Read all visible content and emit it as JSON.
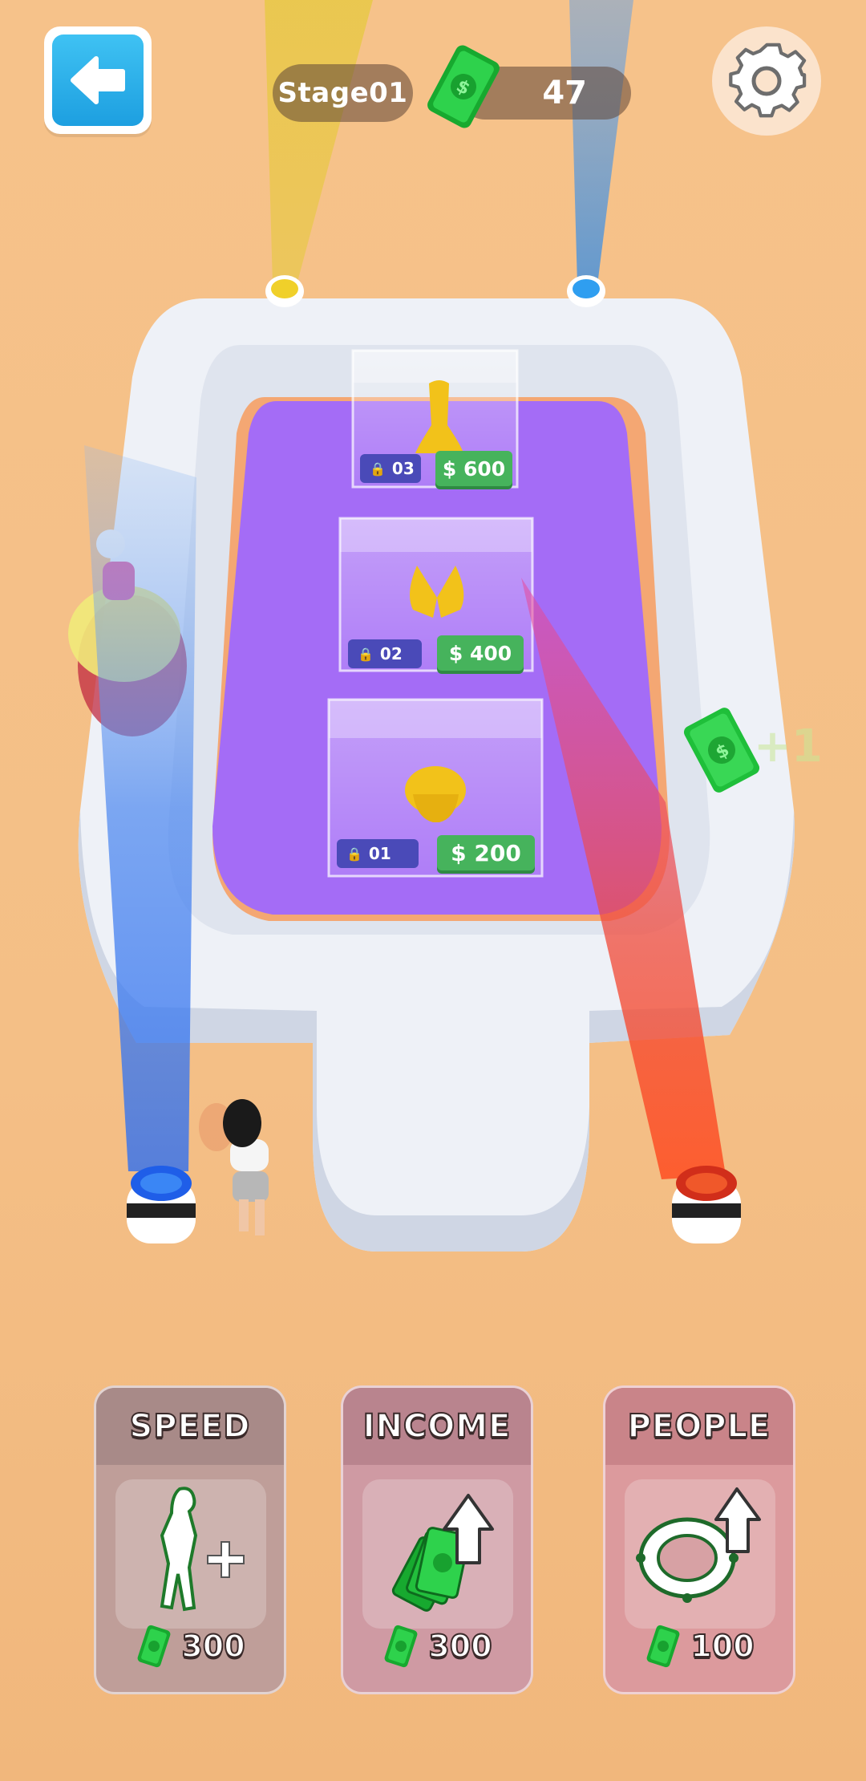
{
  "hud": {
    "stage_label": "Stage01",
    "coin_count": "47",
    "back_icon": "arrow-left-icon",
    "settings_icon": "gear-icon",
    "coin_icon": "cash-icon"
  },
  "showcases": [
    {
      "lock_level": "03",
      "price": "$ 600",
      "item": "gown"
    },
    {
      "lock_level": "02",
      "price": "$ 400",
      "item": "top"
    },
    {
      "lock_level": "01",
      "price": "$ 200",
      "item": "wrap"
    }
  ],
  "floating_reward": "+1",
  "upgrades": [
    {
      "title": "SPEED",
      "cost": "300",
      "icon": "runner-plus-icon"
    },
    {
      "title": "INCOME",
      "cost": "300",
      "icon": "cash-stack-arrow-up-icon"
    },
    {
      "title": "PEOPLE",
      "cost": "100",
      "icon": "ring-arrow-up-icon"
    }
  ],
  "colors": {
    "background": "#f6c28a",
    "stage_floor": "#a46cf6",
    "price_green": "#46b35c",
    "lock_blue": "#4a4ab8",
    "back_blue": "#1d9fe0"
  }
}
